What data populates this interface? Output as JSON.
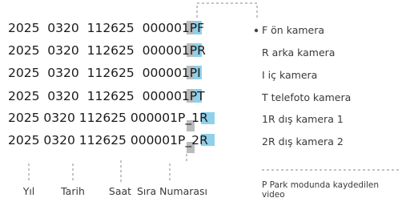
{
  "filenames": [
    "2025  0320  112625  000001PF",
    "2025  0320  112625  000001PR",
    "2025  0320  112625  000001PI",
    "2025  0320  112625  000001PT",
    "2025 0320 112625 000001P_1R",
    "2025 0320 112625 000001P_2R"
  ],
  "legend": [
    "F ön kamera",
    "R arka kamera",
    "I iç kamera",
    "T telefoto kamera",
    "1R dış kamera 1",
    "2R dış kamera 2"
  ],
  "segments": [
    "Yıl",
    "Tarih",
    "Saat",
    "Sıra Numarası"
  ],
  "note": [
    "P Park modunda kaydedilen",
    "video"
  ],
  "colors": {
    "highlight_blue": "#8fd0ea",
    "highlight_gray": "#b9bcbe",
    "guide_line": "#8a8a8a"
  }
}
